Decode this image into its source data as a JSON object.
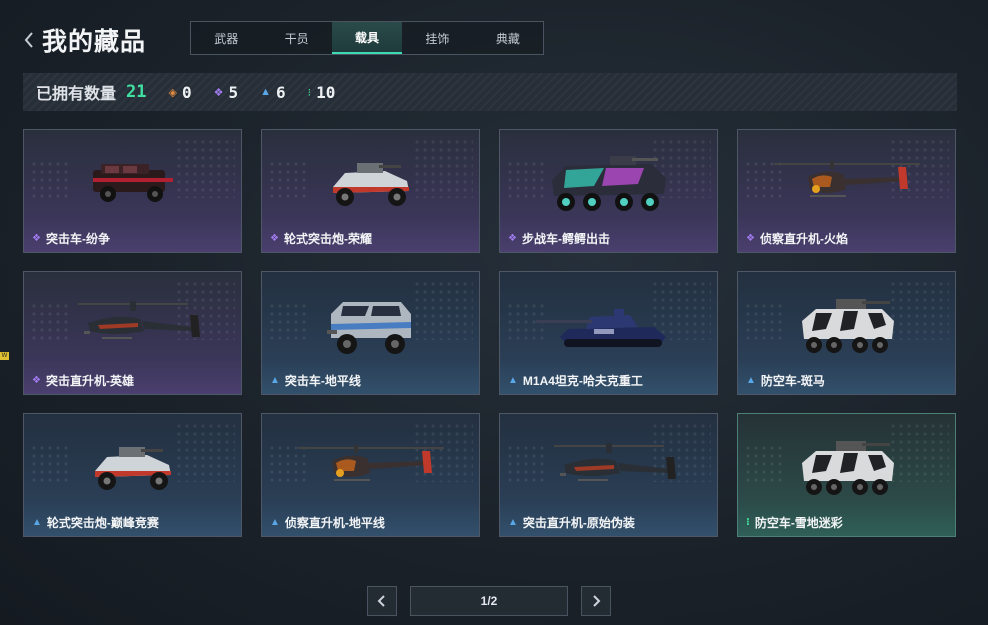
{
  "header": {
    "title": "我的藏品",
    "tabs": [
      {
        "label": "武器",
        "active": false
      },
      {
        "label": "干员",
        "active": false
      },
      {
        "label": "载具",
        "active": true
      },
      {
        "label": "挂饰",
        "active": false
      },
      {
        "label": "典藏",
        "active": false
      }
    ]
  },
  "stats": {
    "label": "已拥有数量",
    "total": "21",
    "counts": [
      {
        "icon": "orange-diamond-icon",
        "color": "#e38c3e",
        "value": "0"
      },
      {
        "icon": "purple-diamond-icon",
        "color": "#a27cf0",
        "value": "5"
      },
      {
        "icon": "blue-triangle-icon",
        "color": "#5aa7e8",
        "value": "6"
      },
      {
        "icon": "green-dots-icon",
        "color": "#3fe0a0",
        "value": "10"
      }
    ]
  },
  "cards": [
    {
      "name": "突击车-纷争",
      "rarity": "purple",
      "vehicle": "suv-icon"
    },
    {
      "name": "轮式突击炮-荣耀",
      "rarity": "purple",
      "vehicle": "buggy-icon"
    },
    {
      "name": "步战车-鳄鳄出击",
      "rarity": "purple",
      "vehicle": "apc-icon"
    },
    {
      "name": "侦察直升机-火焰",
      "rarity": "purple",
      "vehicle": "scout-heli-icon"
    },
    {
      "name": "突击直升机-英雄",
      "rarity": "purple",
      "vehicle": "attack-heli-icon"
    },
    {
      "name": "突击车-地平线",
      "rarity": "blue",
      "vehicle": "armored-truck-icon"
    },
    {
      "name": "M1A4坦克-哈夫克重工",
      "rarity": "blue",
      "vehicle": "tank-icon"
    },
    {
      "name": "防空车-斑马",
      "rarity": "blue",
      "vehicle": "aa-vehicle-icon"
    },
    {
      "name": "轮式突击炮-巅峰竞赛",
      "rarity": "blue",
      "vehicle": "buggy-icon"
    },
    {
      "name": "侦察直升机-地平线",
      "rarity": "blue",
      "vehicle": "scout-heli-icon"
    },
    {
      "name": "突击直升机-原始伪装",
      "rarity": "blue",
      "vehicle": "attack-heli-icon"
    },
    {
      "name": "防空车-雪地迷彩",
      "rarity": "green",
      "vehicle": "aa-vehicle-icon"
    }
  ],
  "pager": {
    "text": "1/2"
  },
  "edge_badge": "W"
}
